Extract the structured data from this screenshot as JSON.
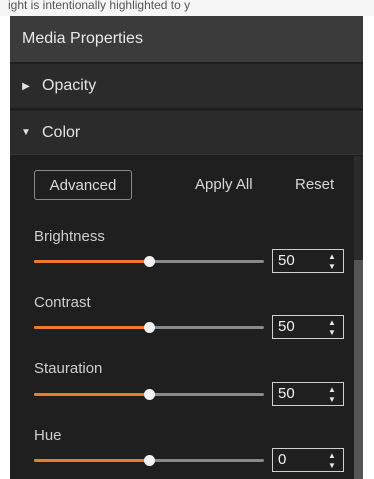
{
  "top_text": "ight is intentionally highlighted to y",
  "panel": {
    "title": "Media Properties",
    "sections": [
      {
        "label": "Opacity",
        "expanded": false
      },
      {
        "label": "Color",
        "expanded": true
      }
    ],
    "toolbar": {
      "advanced_label": "Advanced",
      "apply_all_label": "Apply All",
      "reset_label": "Reset"
    },
    "properties": [
      {
        "label": "Brightness",
        "value": "50",
        "level": 0.5
      },
      {
        "label": "Contrast",
        "value": "50",
        "level": 0.5
      },
      {
        "label": "Stauration",
        "value": "50",
        "level": 0.5
      },
      {
        "label": "Hue",
        "value": "0",
        "level": 0.5
      }
    ]
  },
  "icons": {
    "collapsed": "caret-right-icon",
    "expanded": "caret-down-icon",
    "spin": "spin-arrows-icon"
  },
  "colors": {
    "accent": "#f07a27",
    "panel_bg": "#1f1f1f",
    "header_bg": "#3b3b3b"
  }
}
